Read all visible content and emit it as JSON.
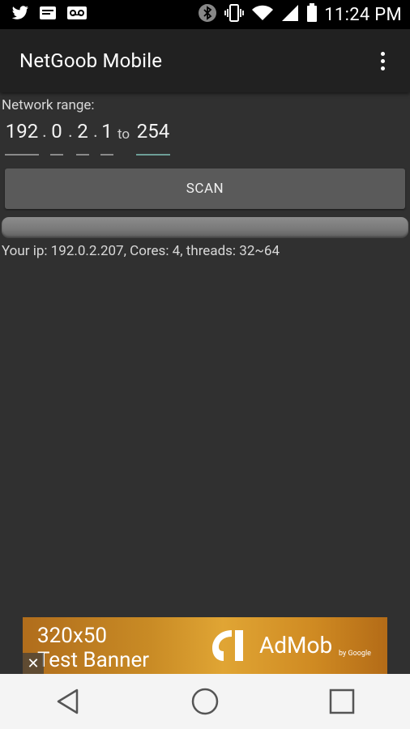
{
  "status_bar": {
    "time": "11:24 PM",
    "icons": [
      "twitter-icon",
      "notification-icon",
      "voicemail-icon",
      "bluetooth-icon",
      "vibrate-icon",
      "wifi-icon",
      "signal-icon",
      "battery-icon"
    ]
  },
  "app_bar": {
    "title": "NetGoob Mobile",
    "menu_icon": "overflow-menu-icon"
  },
  "network_range": {
    "label": "Network range:",
    "octet1": "192",
    "octet2": "0",
    "octet3": "2",
    "octet4": "1",
    "to_label": "to",
    "end": "254"
  },
  "scan_button": {
    "label": "SCAN"
  },
  "info_text": "Your ip: 192.0.2.207, Cores: 4, threads: 32~64",
  "ad_banner": {
    "line1": "320x50",
    "line2": "Test Banner",
    "brand": "AdMob",
    "by": "by Google",
    "close": "✕"
  },
  "nav_bar": {
    "icons": [
      "back-icon",
      "home-icon",
      "recents-icon"
    ]
  },
  "colors": {
    "background": "#303030",
    "app_bar": "#212121",
    "button": "#5a5a5a",
    "accent_underline": "#6d9e97"
  }
}
